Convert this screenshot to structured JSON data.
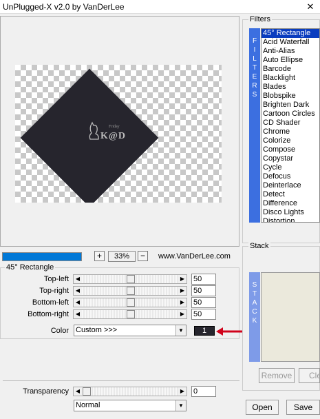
{
  "window": {
    "title": "UnPlugged-X v2.0 by VanDerLee",
    "close_glyph": "✕"
  },
  "preview": {
    "watermark_text": "K@D",
    "watermark_small": "Friday"
  },
  "filters": {
    "group_label": "Filters",
    "strip_letters": [
      "F",
      "I",
      "L",
      "T",
      "E",
      "R",
      "S"
    ],
    "items": [
      "45° Rectangle",
      "Acid Waterfall",
      "Anti-Alias",
      "Auto Ellipse",
      "Barcode",
      "Blacklight",
      "Blades",
      "Blobspike",
      "Brighten Dark",
      "Cartoon Circles",
      "CD Shader",
      "Chrome",
      "Colorize",
      "Compose",
      "Copystar",
      "Cycle",
      "Defocus",
      "Deinterlace",
      "Detect",
      "Difference",
      "Disco Lights",
      "Distortion"
    ],
    "selected_index": 0
  },
  "toolbar": {
    "progress_percent": 100,
    "zoom_in": "+",
    "zoom_value": "33%",
    "zoom_out": "−",
    "website": "www.VanDerLee.com"
  },
  "params": {
    "group_label": "45° Rectangle",
    "rows": [
      {
        "label": "Top-left",
        "value": "50",
        "level": 0.5
      },
      {
        "label": "Top-right",
        "value": "50",
        "level": 0.5
      },
      {
        "label": "Bottom-left",
        "value": "50",
        "level": 0.5
      },
      {
        "label": "Bottom-right",
        "value": "50",
        "level": 0.5
      }
    ],
    "color_label": "Color",
    "color_combo": "Custom >>>",
    "color_index": "1",
    "color_swatch": "#26252d"
  },
  "stack": {
    "group_label": "Stack",
    "strip_letters": [
      "S",
      "T",
      "A",
      "C",
      "K"
    ],
    "remove_label": "Remove",
    "clear_label": "Cle"
  },
  "bottom": {
    "transparency_label": "Transparency",
    "transparency_value": "0",
    "blend_mode": "Normal",
    "open_label": "Open",
    "save_label": "Save"
  },
  "annotation": {
    "arrow_color": "#d0021b"
  }
}
